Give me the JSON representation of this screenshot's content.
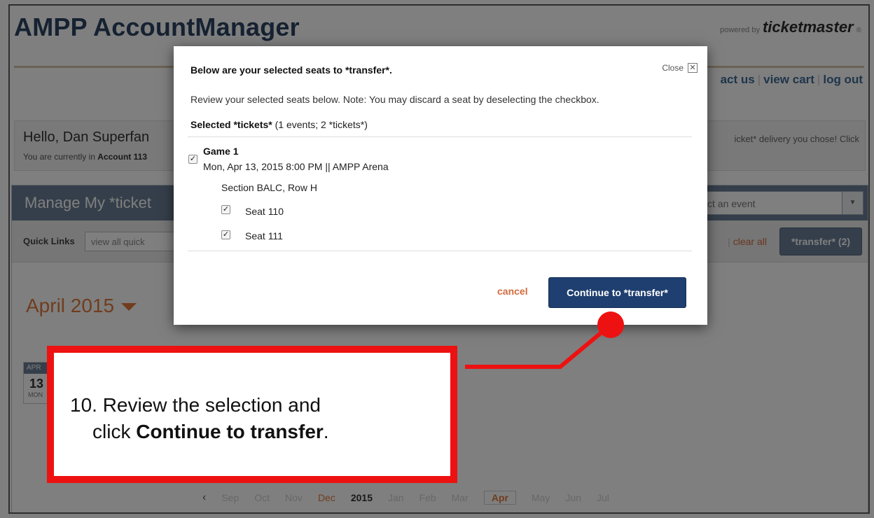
{
  "header": {
    "brand": "AMPP AccountManager",
    "powered_by": "powered by",
    "ticketmaster": "ticketmaster",
    "reg_mark": "®",
    "links": [
      "act us",
      "view cart",
      "log out"
    ]
  },
  "welcome": {
    "hello": "Hello, Dan Superfan",
    "account_prefix": "You are currently in",
    "account_label": "Account 113",
    "delivery_note": "icket* delivery you chose! Click"
  },
  "manage": {
    "title": "Manage My *ticket",
    "event_select": "ct an event",
    "quick_links_label": "Quick Links",
    "quick_links_value": "view all quick",
    "clear_all": "clear all",
    "transfer_button": "*transfer* (2)"
  },
  "calendar": {
    "month_title": "April 2015",
    "card_month": "APR",
    "card_day": "13",
    "card_dow": "MON",
    "nav_prev": "‹",
    "nav_months_before": [
      "Sep",
      "Oct",
      "Nov"
    ],
    "nav_dec": "Dec",
    "nav_year": "2015",
    "nav_months_after_a": [
      "Jan",
      "Feb",
      "Mar"
    ],
    "nav_apr": "Apr",
    "nav_months_after_b": [
      "May",
      "Jun",
      "Jul"
    ]
  },
  "modal": {
    "title": "Below are your selected seats to *transfer*.",
    "close_label": "Close",
    "note": "Review your selected seats below. Note: You may discard a seat by deselecting the checkbox.",
    "selected_bold": "Selected *tickets*",
    "selected_rest": " (1 events; 2 *tickets*)",
    "event_name": "Game 1",
    "event_date": "Mon, Apr 13, 2015 8:00 PM || AMPP Arena",
    "section": "Section BALC, Row H",
    "seats": [
      "Seat 110",
      "Seat 111"
    ],
    "cancel": "cancel",
    "continue": "Continue to *transfer*"
  },
  "callout": {
    "line1": "10. Review the selection and",
    "line2_prefix": "click ",
    "line2_bold": "Continue to transfer",
    "line2_suffix": ".",
    "color": "#ee1111"
  }
}
